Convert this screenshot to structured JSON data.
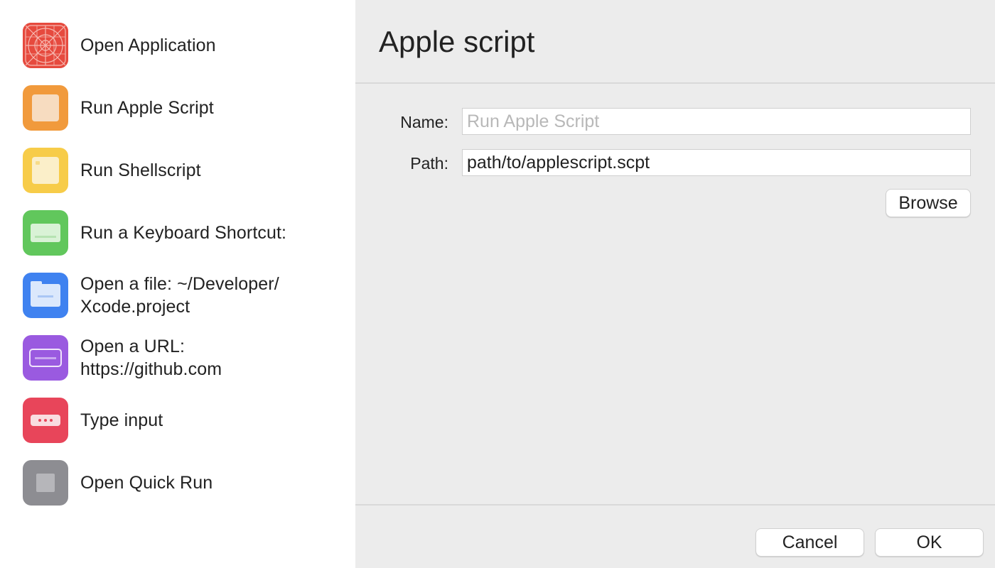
{
  "sidebar": {
    "items": [
      {
        "label": "Open Application",
        "icon": "app-grid-icon",
        "color": "#e64a3e"
      },
      {
        "label": "Run Apple Script",
        "icon": "applescript-icon",
        "color": "#f19a3c"
      },
      {
        "label": "Run Shellscript",
        "icon": "shellscript-icon",
        "color": "#f7cc49"
      },
      {
        "label": "Run a Keyboard Shortcut:",
        "icon": "keyboard-icon",
        "color": "#61c75c"
      },
      {
        "label": "Open a file: ~/Developer/\nXcode.project",
        "icon": "folder-icon",
        "color": "#3f82f0"
      },
      {
        "label": "Open a URL:\nhttps://github.com",
        "icon": "browser-window-icon",
        "color": "#9a5ae0"
      },
      {
        "label": "Type input",
        "icon": "text-input-icon",
        "color": "#e8455a"
      },
      {
        "label": "Open Quick Run",
        "icon": "quick-run-icon",
        "color": "#8d8d92"
      }
    ]
  },
  "panel": {
    "title": "Apple script",
    "name_label": "Name:",
    "name_value": "",
    "name_placeholder": "Run Apple Script",
    "path_label": "Path:",
    "path_value": "path/to/applescript.scpt",
    "browse_label": "Browse"
  },
  "footer": {
    "cancel_label": "Cancel",
    "ok_label": "OK"
  }
}
